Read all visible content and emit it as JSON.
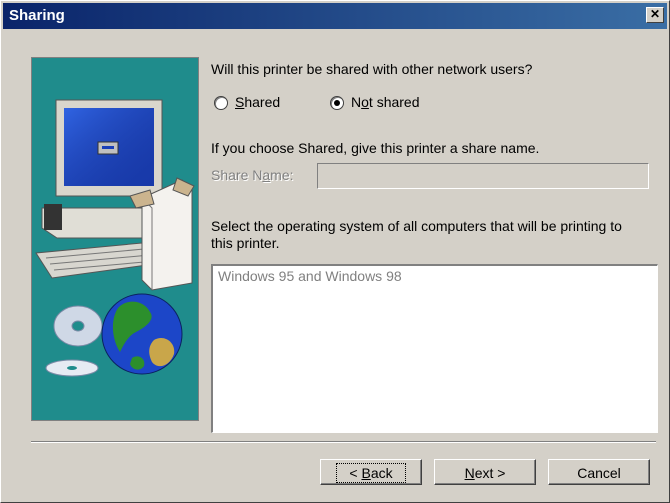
{
  "window": {
    "title": "Sharing",
    "close_glyph": "✕"
  },
  "question": "Will this printer be shared with other network users?",
  "options": {
    "shared": {
      "label_pre": "",
      "label_u": "S",
      "label_post": "hared",
      "selected": false
    },
    "not_shared": {
      "label_pre": "N",
      "label_u": "o",
      "label_post": "t shared",
      "selected": true
    }
  },
  "share_hint": "If you choose Shared, give this printer a share name.",
  "share_name": {
    "label_pre": "Share N",
    "label_u": "a",
    "label_post": "me:",
    "value": ""
  },
  "os_prompt": {
    "line1": "Select the operating system of all computers that will be printing to",
    "line2": "this printer."
  },
  "os_list": {
    "items": [
      "Windows 95 and Windows 98"
    ]
  },
  "buttons": {
    "back": {
      "pre": "< ",
      "u": "B",
      "post": "ack"
    },
    "next": {
      "pre": "",
      "u": "N",
      "post": "ext >"
    },
    "cancel": {
      "label": "Cancel"
    }
  },
  "icons": [
    "computer-icon",
    "cdrom-icon",
    "globe-icon"
  ],
  "colors": {
    "title_bar": "#0a246a",
    "dialog_bg": "#d4d0c8",
    "image_bg": "#1f8c8c"
  }
}
